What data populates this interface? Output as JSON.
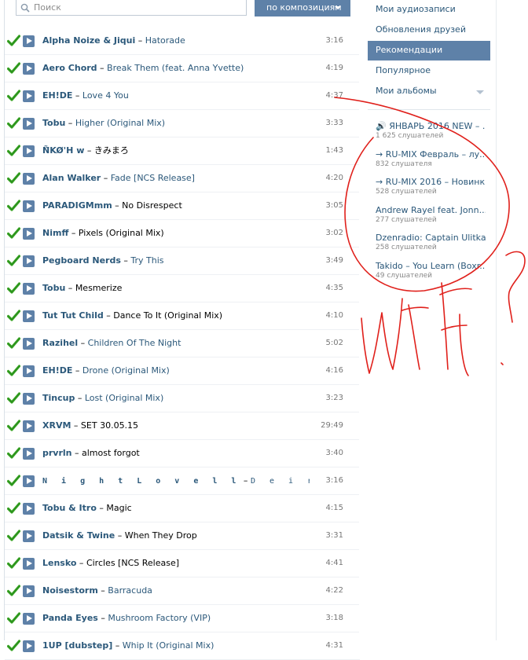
{
  "search": {
    "placeholder": "Поиск",
    "mode_label": "по композициям"
  },
  "tracks": [
    {
      "artist": "Alpha Noize & Jiqui",
      "title": "Hatorade",
      "time": "3:16",
      "plain": false
    },
    {
      "artist": "Aero Chord",
      "title": "Break Them (feat. Anna Yvette)",
      "time": "4:19",
      "plain": false
    },
    {
      "artist": "EH!DE",
      "title": "Love 4 You",
      "time": "4:37",
      "plain": false
    },
    {
      "artist": "Tobu",
      "title": "Higher (Original Mix)",
      "time": "3:33",
      "plain": false
    },
    {
      "artist": "Ñ̈KØ'H ᴡ",
      "title": "きみまろ",
      "time": "1:43",
      "plain": true
    },
    {
      "artist": "Alan Walker",
      "title": "Fade [NCS Release]",
      "time": "4:20",
      "plain": false
    },
    {
      "artist": "PARADIGMmm",
      "title": "No Disrespect",
      "time": "3:05",
      "plain": true
    },
    {
      "artist": "Nimff",
      "title": "Pixels (Original Mix)",
      "time": "3:02",
      "plain": true
    },
    {
      "artist": "Pegboard Nerds",
      "title": "Try This",
      "time": "3:49",
      "plain": false
    },
    {
      "artist": "Tobu",
      "title": "Mesmerize",
      "time": "4:35",
      "plain": true
    },
    {
      "artist": "Tut Tut Child",
      "title": "Dance To It (Original Mix)",
      "time": "4:10",
      "plain": true
    },
    {
      "artist": "Razihel",
      "title": "Children Of The Night",
      "time": "5:02",
      "plain": false
    },
    {
      "artist": "EH!DE",
      "title": "Drone (Original Mix)",
      "time": "4:16",
      "plain": false
    },
    {
      "artist": "Tincup",
      "title": "Lost (Original Mix)",
      "time": "3:23",
      "plain": false
    },
    {
      "artist": "XRVM",
      "title": "SET 30.05.15",
      "time": "29:49",
      "plain": true
    },
    {
      "artist": "prvrln",
      "title": "almost forgot",
      "time": "3:40",
      "plain": true
    },
    {
      "artist": "N i g h t  L o v e l l",
      "title": "D e i r a  c i t y  c e n ...",
      "time": "3:16",
      "plain": false,
      "spaced": true
    },
    {
      "artist": "Tobu & Itro",
      "title": "Magic",
      "time": "4:15",
      "plain": true
    },
    {
      "artist": "Datsik & Twine",
      "title": "When They Drop",
      "time": "3:31",
      "plain": true
    },
    {
      "artist": "Lensko",
      "title": "Circles [NCS Release]",
      "time": "4:41",
      "plain": true
    },
    {
      "artist": "Noisestorm",
      "title": "Barracuda",
      "time": "4:22",
      "plain": false
    },
    {
      "artist": "Panda Eyes",
      "title": "Mushroom Factory (VIP)",
      "time": "3:18",
      "plain": false
    },
    {
      "artist": "1UP [dubstep]",
      "title": "Whip It (Original Mix)",
      "time": "4:31",
      "plain": false
    }
  ],
  "sidebar": {
    "nav": [
      {
        "label": "Мои аудиозаписи",
        "active": false
      },
      {
        "label": "Обновления друзей",
        "active": false
      },
      {
        "label": "Рекомендации",
        "active": true
      },
      {
        "label": "Популярное",
        "active": false
      },
      {
        "label": "Мои альбомы",
        "active": false
      }
    ],
    "recommendations": [
      {
        "title": "🔊 ЯНВАРЬ 2016 NEW – ...",
        "count": "1 625 слушателей"
      },
      {
        "title": "→ RU-MIX Февраль – лу...",
        "count": "832 слушателя"
      },
      {
        "title": "→ RU-MIX 2016 – Новинк...",
        "count": "528 слушателей"
      },
      {
        "title": "Andrew Rayel feat. Jonn...",
        "count": "277 слушателей"
      },
      {
        "title": "Dzenradio: Captain Ulitka'...",
        "count": "258 слушателей"
      },
      {
        "title": "Takido – You Learn (Boxr...",
        "count": "49 слушателей"
      }
    ]
  },
  "colors": {
    "accent": "#5e81a8",
    "link": "#2b587a",
    "annotation": "#e0201b",
    "check": "#3aa524"
  },
  "icons": {
    "check": "check-icon",
    "play": "play-icon",
    "search": "search-icon",
    "dropdown": "chevron-down-icon"
  }
}
